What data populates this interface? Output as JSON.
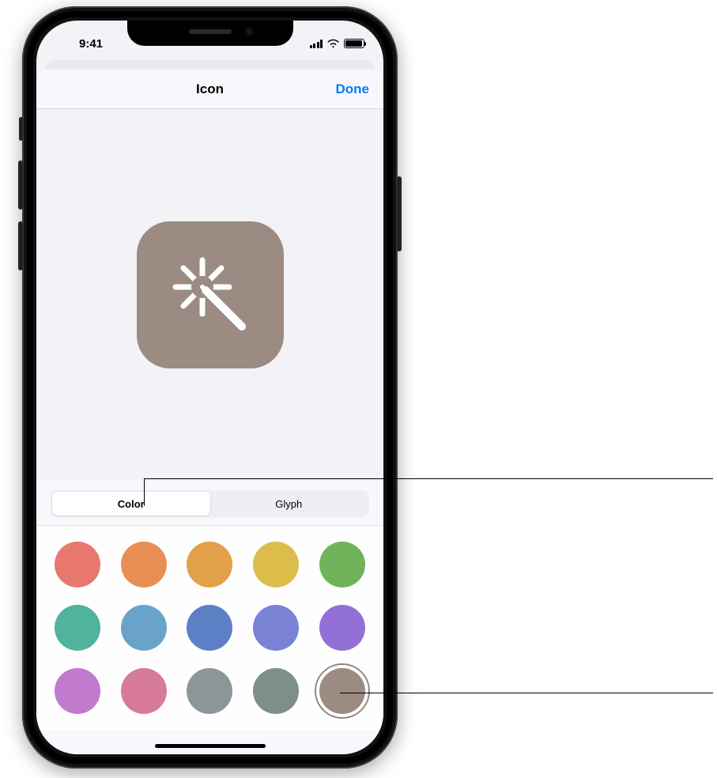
{
  "statusbar": {
    "time": "9:41"
  },
  "sheet": {
    "title": "Icon",
    "done_label": "Done",
    "tabs": {
      "color": "Color",
      "glyph": "Glyph",
      "active": "color"
    },
    "icon_color": "#9b8b82",
    "palette": [
      {
        "hex": "#e8786f",
        "selected": false
      },
      {
        "hex": "#e88f56",
        "selected": false
      },
      {
        "hex": "#e2a148",
        "selected": false
      },
      {
        "hex": "#dcbd4c",
        "selected": false
      },
      {
        "hex": "#6fb35a",
        "selected": false
      },
      {
        "hex": "#4fb39e",
        "selected": false
      },
      {
        "hex": "#6aa3c9",
        "selected": false
      },
      {
        "hex": "#5d7fc5",
        "selected": false
      },
      {
        "hex": "#7a82d6",
        "selected": false
      },
      {
        "hex": "#9270d6",
        "selected": false
      },
      {
        "hex": "#c17acd",
        "selected": false
      },
      {
        "hex": "#d87a9c",
        "selected": false
      },
      {
        "hex": "#8c9699",
        "selected": false
      },
      {
        "hex": "#7d8f89",
        "selected": false
      },
      {
        "hex": "#9b8b82",
        "selected": true
      }
    ]
  }
}
